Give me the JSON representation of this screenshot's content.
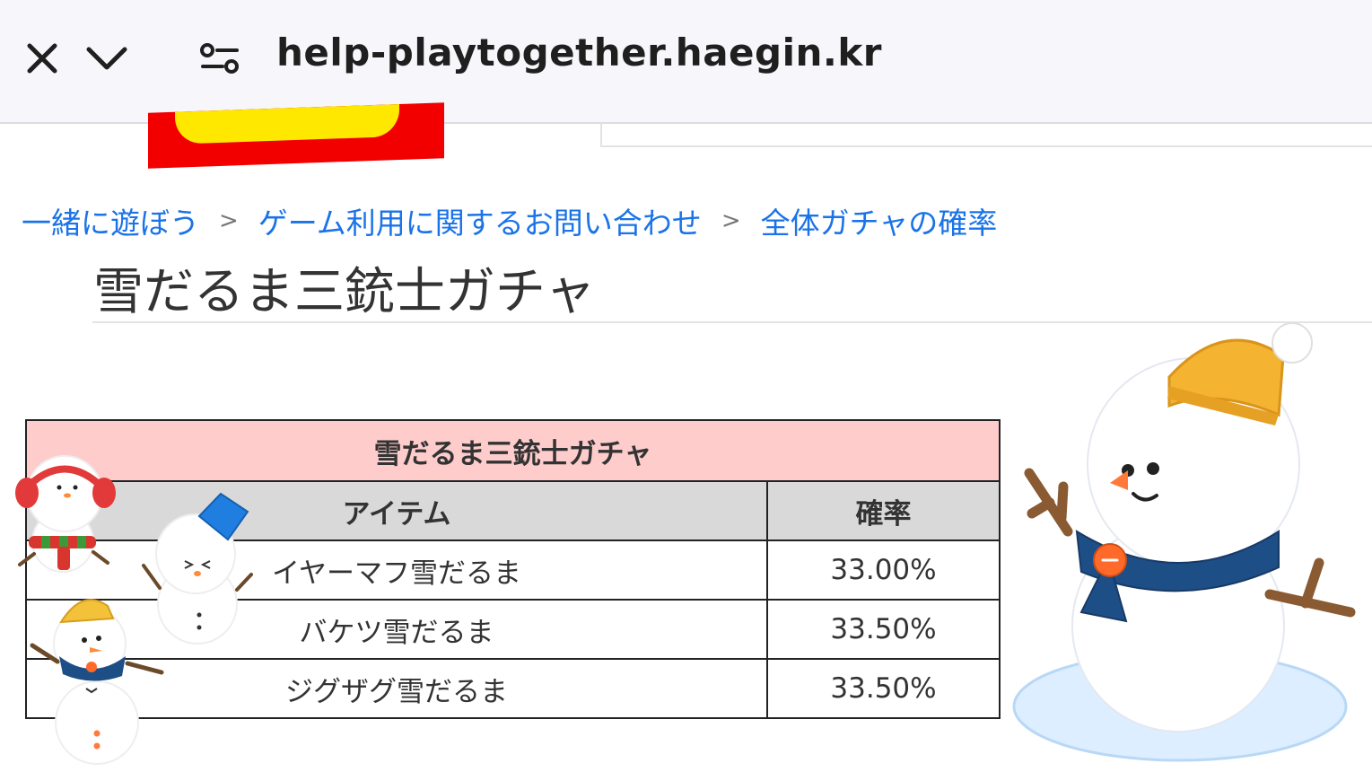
{
  "browser": {
    "url": "help-playtogether.haegin.kr",
    "close_icon": "close-icon",
    "dropdown_icon": "chevron-down-icon",
    "site_settings_icon": "tune-icon"
  },
  "breadcrumb": {
    "items": [
      "一緒に遊ぼう",
      "ゲーム利用に関するお問い合わせ",
      "全体ガチャの確率"
    ],
    "separator": ">"
  },
  "page": {
    "title": "雪だるま三銃士ガチャ"
  },
  "table": {
    "caption": "雪だるま三銃士ガチャ",
    "headers": [
      "アイテム",
      "確率"
    ],
    "rows": [
      {
        "item": "イヤーマフ雪だるま",
        "rate": "33.00%"
      },
      {
        "item": "バケツ雪だるま",
        "rate": "33.50%"
      },
      {
        "item": "ジグザグ雪だるま",
        "rate": "33.50%"
      }
    ]
  },
  "colors": {
    "link": "#1a73e8",
    "caption_bg": "#ffcccc",
    "header_bg": "#d9d9d9",
    "logo_red": "#f20000",
    "logo_yellow": "#ffe800"
  }
}
